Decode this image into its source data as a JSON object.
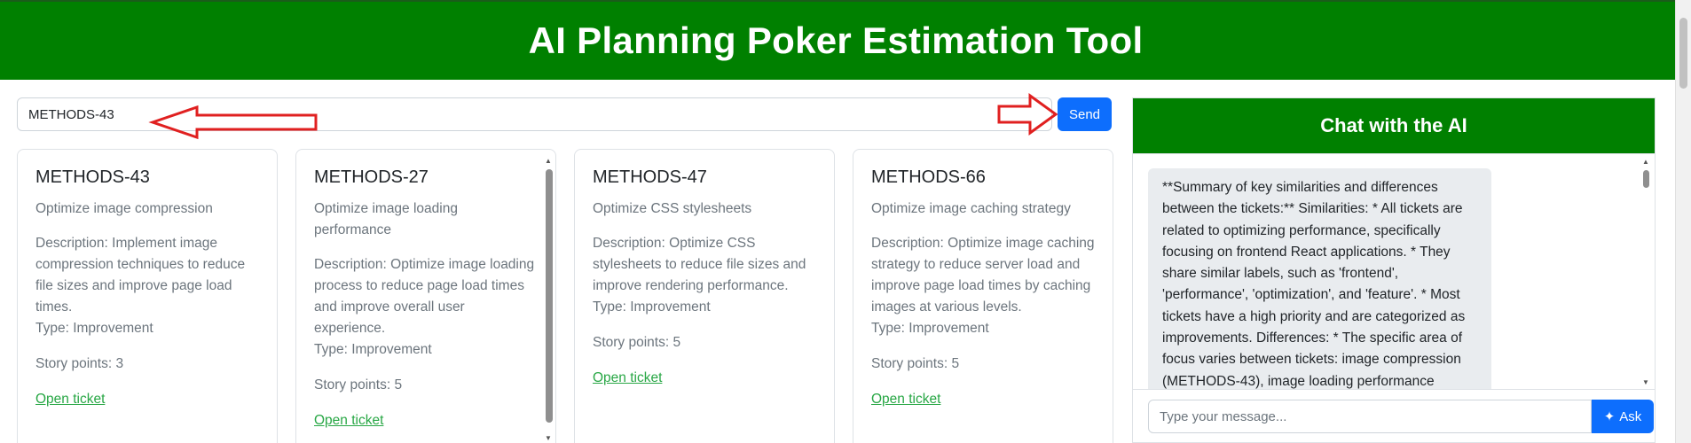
{
  "header": {
    "title": "AI Planning Poker Estimation Tool"
  },
  "search": {
    "value": "METHODS-43",
    "send_label": "Send"
  },
  "tickets": [
    {
      "key": "METHODS-43",
      "summary": "Optimize image compression",
      "description": "Description: Implement image compression techniques to reduce file sizes and improve page load times.",
      "type": "Type: Improvement",
      "story_points": "Story points: 3",
      "link": "Open ticket"
    },
    {
      "key": "METHODS-27",
      "summary": "Optimize image loading performance",
      "description": "Description: Optimize image loading process to reduce page load times and improve overall user experience.",
      "type": "Type: Improvement",
      "story_points": "Story points: 5",
      "link": "Open ticket"
    },
    {
      "key": "METHODS-47",
      "summary": "Optimize CSS stylesheets",
      "description": "Description: Optimize CSS stylesheets to reduce file sizes and improve rendering performance.",
      "type": "Type: Improvement",
      "story_points": "Story points: 5",
      "link": "Open ticket"
    },
    {
      "key": "METHODS-66",
      "summary": "Optimize image caching strategy",
      "description": "Description: Optimize image caching strategy to reduce server load and improve page load times by caching images at various levels.",
      "type": "Type: Improvement",
      "story_points": "Story points: 5",
      "link": "Open ticket"
    }
  ],
  "chat": {
    "title": "Chat with the AI",
    "message": "**Summary of key similarities and differences between the tickets:** Similarities: * All tickets are related to optimizing performance, specifically focusing on frontend React applications. * They share similar labels, such as 'frontend', 'performance', 'optimization', and 'feature'. * Most tickets have a high priority and are categorized as improvements. Differences: * The specific area of focus varies between tickets: image compression (METHODS-43), image loading performance",
    "input_placeholder": "Type your message...",
    "ask_label": "Ask"
  },
  "colors": {
    "brand_green": "#008000",
    "primary_blue": "#0d6efd",
    "link_green": "#28a745",
    "annotation_red": "#e02020"
  },
  "icons": {
    "send_arrow": "red-arrow-icon",
    "ask": "sparkles-icon"
  }
}
